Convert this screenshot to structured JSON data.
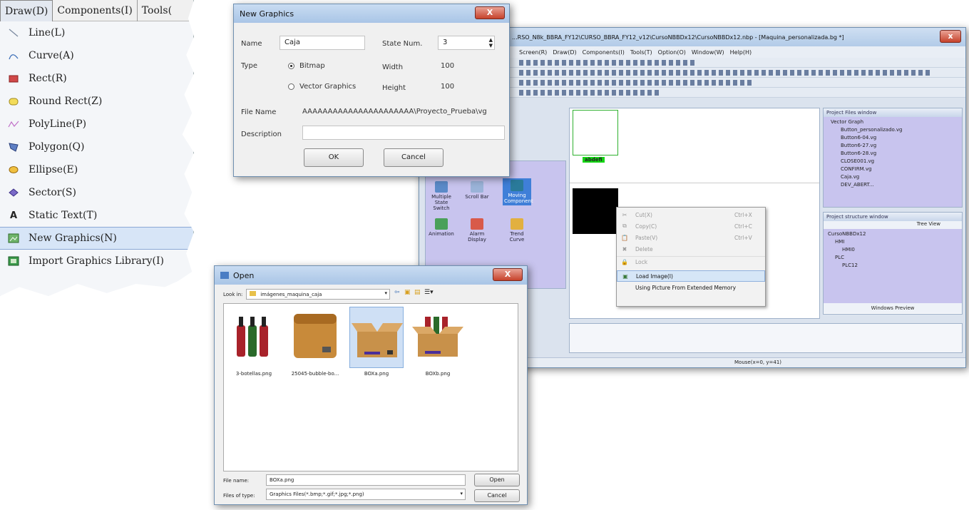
{
  "draw_menu": {
    "menubar": [
      "Draw(D)",
      "Components(I)",
      "Tools("
    ],
    "items": [
      {
        "label": "Line(L)",
        "icon": "line-icon"
      },
      {
        "label": "Curve(A)",
        "icon": "curve-icon"
      },
      {
        "label": "Rect(R)",
        "icon": "rect-icon"
      },
      {
        "label": "Round Rect(Z)",
        "icon": "round-rect-icon"
      },
      {
        "label": "PolyLine(P)",
        "icon": "polyline-icon"
      },
      {
        "label": "Polygon(Q)",
        "icon": "polygon-icon"
      },
      {
        "label": "Ellipse(E)",
        "icon": "ellipse-icon"
      },
      {
        "label": "Sector(S)",
        "icon": "sector-icon"
      },
      {
        "label": "Static Text(T)",
        "icon": "static-text-icon"
      },
      {
        "label": "New Graphics(N)",
        "icon": "new-graphics-icon"
      },
      {
        "label": "Import Graphics Library(I)",
        "icon": "import-library-icon"
      }
    ]
  },
  "new_graphics": {
    "title": "New Graphics",
    "close": "X",
    "name_label": "Name",
    "name_value": "Caja",
    "state_num_label": "State Num.",
    "state_num_value": "3",
    "type_label": "Type",
    "bitmap_label": "Bitmap",
    "vector_label": "Vector Graphics",
    "width_label": "Width",
    "width_value": "100",
    "height_label": "Height",
    "height_value": "100",
    "file_name_label": "File Name",
    "file_name_value": "AAAAAAAAAAAAAAAAAAAAAA\\Proyecto_Prueba\\vg",
    "description_label": "Description",
    "ok": "OK",
    "cancel": "Cancel"
  },
  "main_app": {
    "title": "...RSO_N8k_BBRA_FY12\\CURSO_BBRA_FY12_v12\\CursoNBBDx12\\CursoNBBDx12.nbp - [Maquina_personalizada.bg *]",
    "menus": [
      "Screen(R)",
      "Draw(D)",
      "Components(I)",
      "Tools(T)",
      "Option(O)",
      "Window(W)",
      "Help(H)"
    ],
    "green_label": "abdefi",
    "components": [
      {
        "label": "Multiple State Switch"
      },
      {
        "label": "Scroll Bar"
      },
      {
        "label": "Moving Component"
      },
      {
        "label": "Animation"
      },
      {
        "label": "Alarm Display"
      },
      {
        "label": "Trend Curve"
      }
    ],
    "project_files": {
      "title": "Project Files window",
      "root": "Vector Graph",
      "items": [
        "Button_personalizado.vg",
        "Button6-04.vg",
        "Button6-27.vg",
        "Button6-28.vg",
        "CLOSE001.vg",
        "CONFIRM.vg",
        "Caja.vg",
        "DEV_ABERT..."
      ]
    },
    "project_structure": {
      "title": "Project structure window",
      "tree_view": "Tree View",
      "items": [
        "CursoNBBDx12",
        "HMI",
        "HMI0",
        "PLC",
        "PLC12"
      ],
      "windows_preview": "Windows Preview"
    },
    "status": "Mouse(x=0, y=41)",
    "context_menu": [
      {
        "label": "Cut(X)",
        "shortcut": "Ctrl+X",
        "icon": "cut-icon"
      },
      {
        "label": "Copy(C)",
        "shortcut": "Ctrl+C",
        "icon": "copy-icon"
      },
      {
        "label": "Paste(V)",
        "shortcut": "Ctrl+V",
        "icon": "paste-icon"
      },
      {
        "label": "Delete",
        "shortcut": "",
        "icon": "delete-icon"
      },
      {
        "label": "Lock",
        "shortcut": "",
        "icon": "lock-icon"
      },
      {
        "label": "Load Image(I)",
        "shortcut": "",
        "icon": "load-image-icon"
      },
      {
        "label": "Using Picture From Extended Memory",
        "shortcut": "",
        "icon": ""
      }
    ]
  },
  "open_dialog": {
    "title": "Open",
    "close": "X",
    "look_in_label": "Look in:",
    "look_in_value": "imágenes_maquina_caja",
    "files": [
      {
        "label": "3-botellas.png"
      },
      {
        "label": "25045-bubble-bo..."
      },
      {
        "label": "BOXa.png"
      },
      {
        "label": "BOXb.png"
      }
    ],
    "file_name_label": "File name:",
    "file_name_value": "BOXa.png",
    "file_type_label": "Files of type:",
    "file_type_value": "Graphics Files(*.bmp;*.gif;*.jpg;*.png)",
    "open": "Open",
    "cancel": "Cancel"
  }
}
